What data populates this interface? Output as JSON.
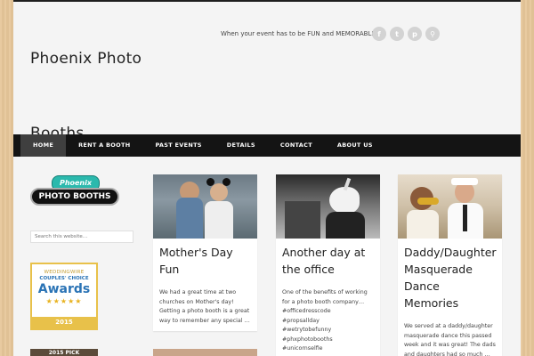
{
  "header": {
    "site_title_line1": "Phoenix Photo",
    "site_title_line2": "Booths",
    "tagline": "When your event has to be FUN and MEMORABLE",
    "social": [
      {
        "icon": "facebook-icon",
        "glyph": "f"
      },
      {
        "icon": "twitter-icon",
        "glyph": "t"
      },
      {
        "icon": "pinterest-icon",
        "glyph": "p"
      },
      {
        "icon": "search-icon",
        "glyph": "⚲"
      }
    ]
  },
  "nav": {
    "items": [
      {
        "label": "HOME"
      },
      {
        "label": "RENT A BOOTH"
      },
      {
        "label": "PAST EVENTS"
      },
      {
        "label": "DETAILS"
      },
      {
        "label": "CONTACT"
      },
      {
        "label": "ABOUT US"
      }
    ]
  },
  "sidebar": {
    "logo_top": "Phoenix",
    "logo_bottom": "PHOTO BOOTHS",
    "search_placeholder": "Search this website…",
    "award": {
      "brand": "WEDDINGWIRE",
      "subtitle": "COUPLES' CHOICE",
      "title": "Awards",
      "stars": "★★★★★",
      "year": "2015"
    },
    "badge_partial": "2015 PICK"
  },
  "posts": [
    {
      "title": "Mother's Day Fun",
      "excerpt": "We had a great time at two churches on Mother's day! Getting a photo booth is a great way to remember any special …"
    },
    {
      "title": "Another day at the office",
      "excerpt": "One of the benefits of working for a photo booth company…",
      "tags": [
        "#officedresscode",
        "#propsallday",
        "#wetrytobefunny",
        "#phxphotobooths",
        "#unicornselfie"
      ]
    },
    {
      "title": "Daddy/Daughter Masquerade Dance Memories",
      "excerpt": " We served at a daddy/daughter masquerade dance this passed week and it was great! The dads and daughters had so much …"
    }
  ],
  "colors": {
    "nav_bg": "#141414",
    "nav_active": "#3f3f3f",
    "page_bg": "#f4f4f4",
    "body_bg": "#e7c79a",
    "accent_teal": "#2bb9ad"
  }
}
